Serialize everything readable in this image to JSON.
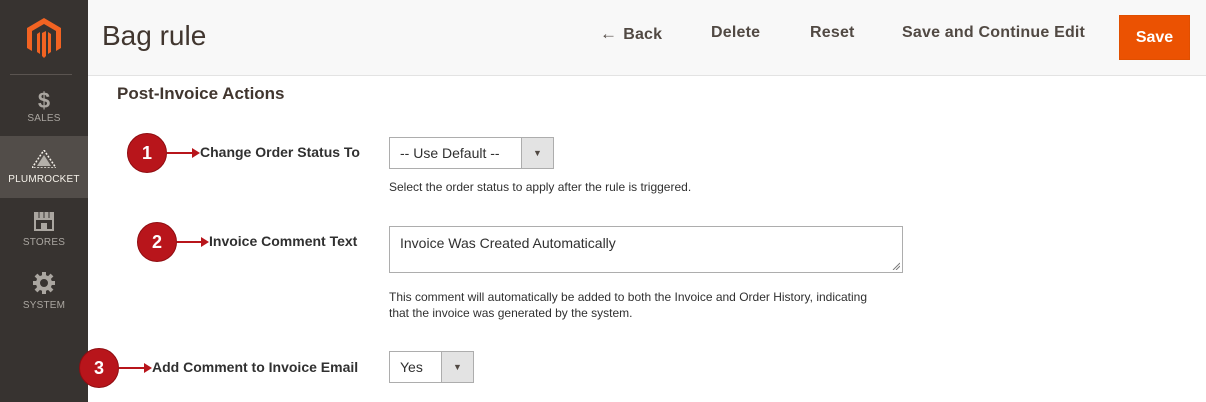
{
  "sidebar": {
    "items": [
      {
        "label": "SALES",
        "icon": "dollar-icon"
      },
      {
        "label": "PLUMROCKET",
        "icon": "plumrocket-icon"
      },
      {
        "label": "STORES",
        "icon": "store-icon"
      },
      {
        "label": "SYSTEM",
        "icon": "gear-icon"
      }
    ]
  },
  "header": {
    "title": "Bag rule",
    "back_label": "Back",
    "delete_label": "Delete",
    "reset_label": "Reset",
    "save_continue_label": "Save and Continue Edit",
    "save_label": "Save"
  },
  "section": {
    "title": "Post-Invoice Actions"
  },
  "fields": {
    "order_status": {
      "label": "Change Order Status To",
      "value": "-- Use Default --",
      "note": "Select the order status to apply after the rule is triggered."
    },
    "invoice_comment": {
      "label": "Invoice Comment Text",
      "value": "Invoice Was Created Automatically",
      "note_line1": "This comment will automatically be added to both the Invoice and Order History, indicating",
      "note_line2": "that the invoice was generated by the system."
    },
    "add_comment_email": {
      "label": "Add Comment to Invoice Email",
      "value": "Yes"
    }
  },
  "annotations": [
    "1",
    "2",
    "3"
  ],
  "colors": {
    "accent": "#eb5202",
    "sidebar": "#373330",
    "annotation": "#b8151b"
  }
}
